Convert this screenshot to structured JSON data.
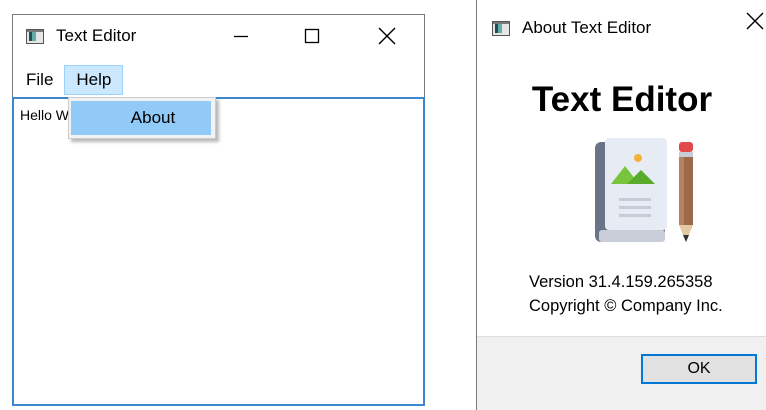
{
  "editor": {
    "title": "Text Editor",
    "menu": [
      "File",
      "Help"
    ],
    "dropdown": {
      "items": [
        "About"
      ]
    },
    "content": "Hello World"
  },
  "about": {
    "title": "About Text Editor",
    "heading": "Text Editor",
    "version": "Version 31.4.159.265358",
    "copyright": "Copyright © Company Inc.",
    "ok_label": "OK"
  },
  "icons": {
    "app": "app-window-icon",
    "minimize": "minimize-icon",
    "maximize": "maximize-icon",
    "close": "close-icon",
    "logo": "notebook-pencil-logo"
  },
  "colors": {
    "accent": "#0078d7",
    "menu_highlight": "#cce8ff",
    "dropdown_highlight": "#91c9f7",
    "text_border": "#3d87d1"
  }
}
